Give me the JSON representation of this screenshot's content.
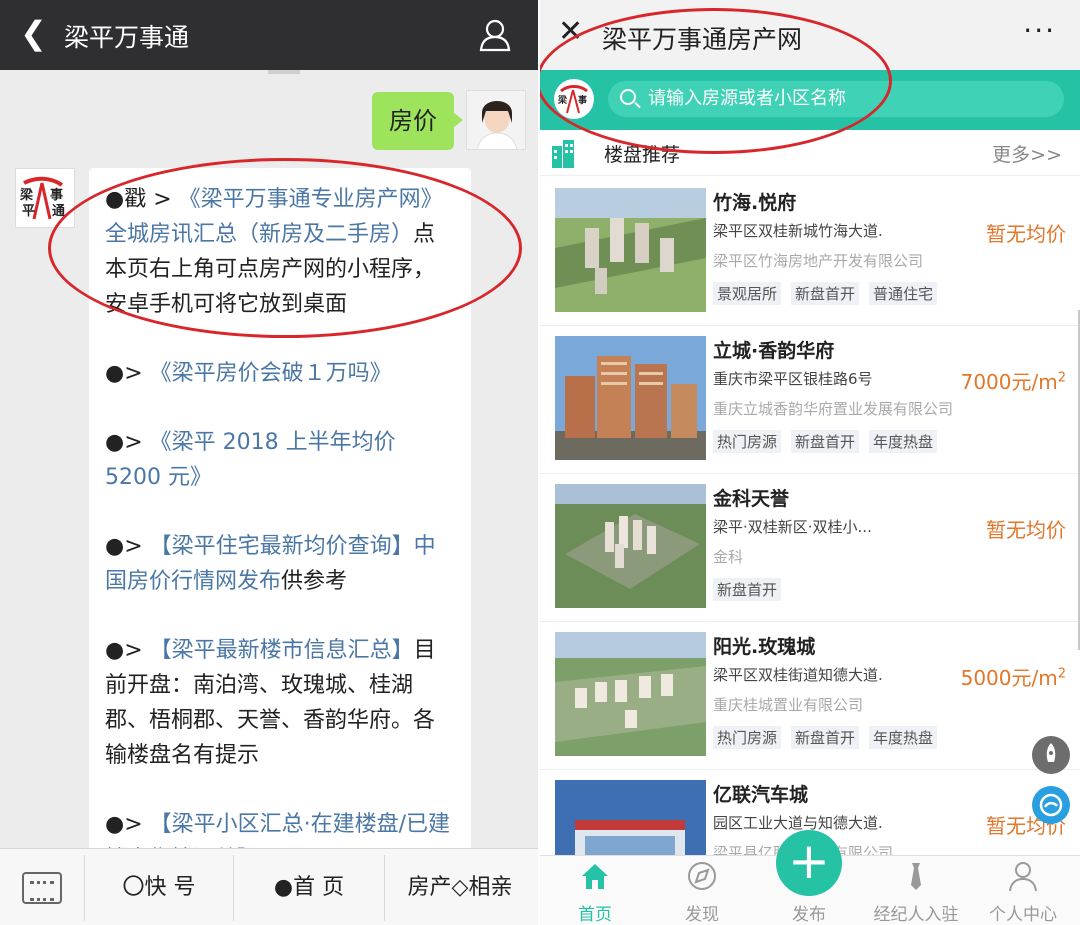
{
  "left": {
    "header": {
      "back_icon": "back-chevron-icon",
      "title": "梁平万事通",
      "person_icon": "person-icon"
    },
    "my_message": "房价",
    "logo_text": "梁平事通",
    "paragraphs": [
      {
        "prefix": "●戳 > ",
        "link": "《梁平万事通专业房产网》全城房讯汇总（新房及二手房）",
        "suffix": "点本页右上角可点房产网的小程序，安卓手机可将它放到桌面"
      },
      {
        "prefix": "●> ",
        "link": "《梁平房价会破１万吗》",
        "suffix": ""
      },
      {
        "prefix": "●> ",
        "link": "《梁平 2018 上半年均价 5200 元》",
        "suffix": ""
      },
      {
        "prefix": "●> ",
        "link": "【梁平住宅最新均价查询】中国房价行情网发布",
        "suffix": "供参考"
      },
      {
        "prefix": "●> ",
        "link": "【梁平最新楼市信息汇总】",
        "suffix": "目前开盘：南泊湾、玫瑰城、桂湖郡、梧桐郡、天誉、香韵华府。各输楼盘名有提示"
      },
      {
        "prefix": "●> ",
        "link": "【梁平小区汇总·在建楼盘/已建楼盘售楼汇总】",
        "suffix": ""
      }
    ],
    "input_bar": {
      "keyboard_icon": "keyboard-icon",
      "menus": [
        "〇快 号",
        "●首 页",
        "房产◇相亲"
      ]
    }
  },
  "right": {
    "header": {
      "close_icon": "close-icon",
      "title": "梁平万事通房产网",
      "more": "···"
    },
    "search": {
      "placeholder": "请输入房源或者小区名称",
      "logo_text": "梁平事"
    },
    "section": {
      "title": "楼盘推荐",
      "more": "更多>>"
    },
    "listings": [
      {
        "name": "竹海.悦府",
        "address": "梁平区双桂新城竹海大道.",
        "developer": "梁平区竹海房地产开发有限公司",
        "price": "暂无均价",
        "unit": "",
        "tags": [
          "景观居所",
          "新盘首开",
          "普通住宅"
        ]
      },
      {
        "name": "立城·香韵华府",
        "address": "重庆市梁平区银桂路6号",
        "developer": "重庆立城香韵华府置业发展有限公司",
        "price": "7000元/m",
        "unit": "2",
        "tags": [
          "热门房源",
          "新盘首开",
          "年度热盘"
        ]
      },
      {
        "name": "金科天誉",
        "address": "梁平·双桂新区·双桂小...",
        "developer": "金科",
        "price": "暂无均价",
        "unit": "",
        "tags": [
          "新盘首开"
        ]
      },
      {
        "name": "阳光.玫瑰城",
        "address": "梁平区双桂街道知德大道.",
        "developer": "重庆桂城置业有限公司",
        "price": "5000元/m",
        "unit": "2",
        "tags": [
          "热门房源",
          "新盘首开",
          "年度热盘"
        ]
      },
      {
        "name": "亿联汽车城",
        "address": "园区工业大道与知德大道.",
        "developer": "梁平县亿联汽车城有限公司",
        "price": "暂无均价",
        "unit": "",
        "tags": []
      }
    ],
    "tabbar": {
      "tabs": [
        {
          "label": "首页",
          "icon": "home-icon"
        },
        {
          "label": "发现",
          "icon": "discover-icon"
        },
        {
          "label": "发布",
          "icon": "plus-icon"
        },
        {
          "label": "经纪人入驻",
          "icon": "tie-icon"
        },
        {
          "label": "个人中心",
          "icon": "person-icon"
        }
      ],
      "publish_symbol": "+"
    },
    "colors": {
      "accent": "#25c2a6",
      "price": "#e2762a",
      "annotation": "#d8262a"
    }
  }
}
